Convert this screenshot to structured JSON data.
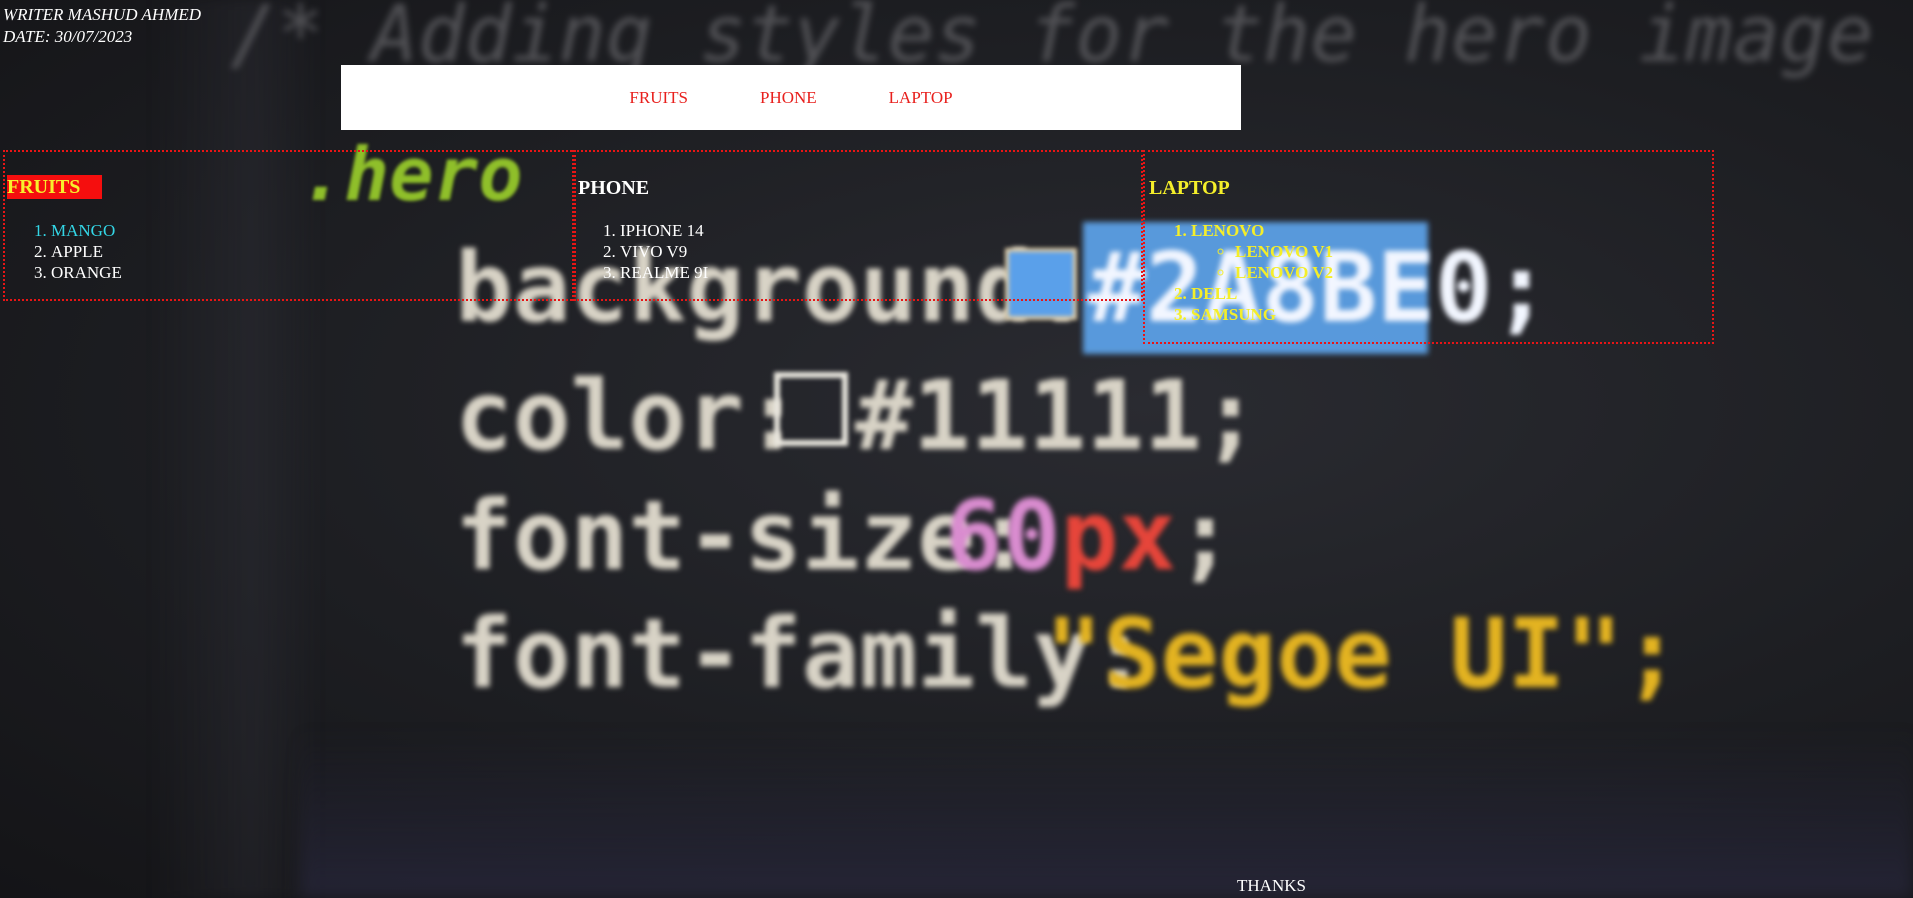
{
  "meta": {
    "writer": "WRITER MASHUD AHMED",
    "date": "DATE: 30/07/2023"
  },
  "nav": {
    "items": [
      "FRUITS",
      "PHONE",
      "LAPTOP"
    ]
  },
  "sections": {
    "fruits": {
      "title": "FRUITS",
      "items": [
        "MANGO",
        "APPLE",
        "ORANGE"
      ]
    },
    "phone": {
      "title": "PHONE",
      "items": [
        "IPHONE 14",
        "VIVO V9",
        "REALME 9I"
      ]
    },
    "laptop": {
      "title": "LAPTOP",
      "items": [
        {
          "label": "LENOVO",
          "sub": [
            "LENOVO V1",
            "LENOVO V2"
          ]
        },
        {
          "label": "DELL"
        },
        {
          "label": "SAMSUNG"
        }
      ]
    }
  },
  "footer": {
    "text": "THANKS"
  },
  "background": {
    "comment_line": "/* Adding styles for the hero image",
    "selector": ".hero",
    "line1_prop": "background:",
    "line1_val": "#2A8BE0;",
    "line2_prop": "color:",
    "line2_val": "#11111;",
    "line3_prop": "font-size:",
    "line3_num": "60",
    "line3_unit": "px",
    "line4_prop": "font-family:",
    "line4_val": "\"Segoe UI\";"
  },
  "colors": {
    "nav_link": "#e8201d",
    "panel_border": "#e81515",
    "fruits_title_bg": "#f50e0e",
    "fruits_title_text": "#f7ef2c",
    "mango": "#33d6e6",
    "laptop_text": "#f4ee2a",
    "text": "#ffffff"
  }
}
